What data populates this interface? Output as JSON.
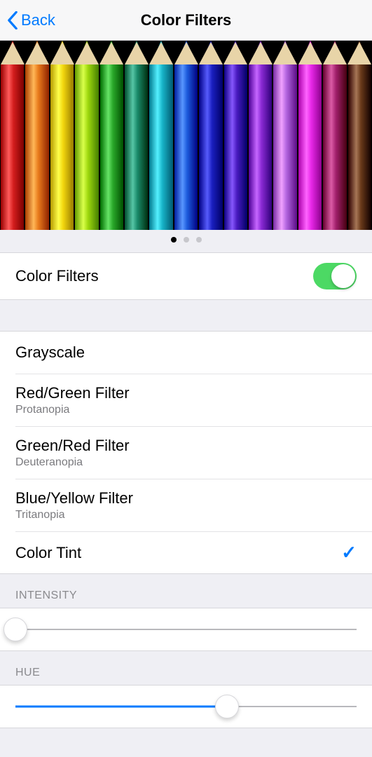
{
  "nav": {
    "back_label": "Back",
    "title": "Color Filters"
  },
  "pencils": [
    "#d41e1e",
    "#e87b1c",
    "#f2d60e",
    "#9ed80e",
    "#2aa82a",
    "#1a8a6a",
    "#18b4c9",
    "#1d5bdc",
    "#1a1fc0",
    "#4a1bc0",
    "#8a2ad4",
    "#b466e0",
    "#e828e8",
    "#a01f6a",
    "#6a3a1a"
  ],
  "pager": {
    "count": 3,
    "active": 0
  },
  "toggle": {
    "label": "Color Filters",
    "on": true
  },
  "filters": [
    {
      "title": "Grayscale",
      "subtitle": "",
      "selected": false
    },
    {
      "title": "Red/Green Filter",
      "subtitle": "Protanopia",
      "selected": false
    },
    {
      "title": "Green/Red Filter",
      "subtitle": "Deuteranopia",
      "selected": false
    },
    {
      "title": "Blue/Yellow Filter",
      "subtitle": "Tritanopia",
      "selected": false
    },
    {
      "title": "Color Tint",
      "subtitle": "",
      "selected": true
    }
  ],
  "sliders": {
    "intensity": {
      "header": "INTENSITY",
      "value": 0.0
    },
    "hue": {
      "header": "HUE",
      "value": 0.62
    }
  }
}
